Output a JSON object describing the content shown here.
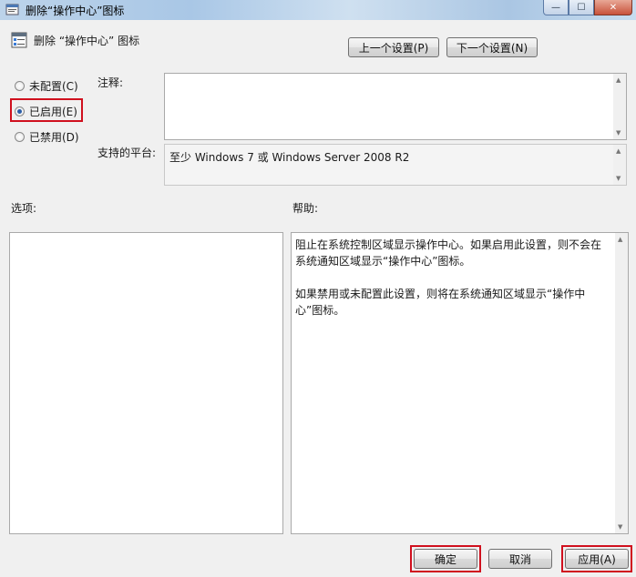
{
  "window": {
    "title": "删除“操作中心”图标"
  },
  "header": {
    "policy_name": "删除 “操作中心” 图标",
    "prev_setting": "上一个设置(P)",
    "next_setting": "下一个设置(N)"
  },
  "radios": [
    {
      "label": "未配置(C)",
      "checked": false
    },
    {
      "label": "已启用(E)",
      "checked": true
    },
    {
      "label": "已禁用(D)",
      "checked": false
    }
  ],
  "comment": {
    "label": "注释:",
    "value": ""
  },
  "platform": {
    "label": "支持的平台:",
    "value": "至少 Windows 7 或 Windows Server 2008 R2"
  },
  "options": {
    "label": "选项:"
  },
  "help": {
    "label": "帮助:",
    "para1": "阻止在系统控制区域显示操作中心。如果启用此设置，则不会在系统通知区域显示“操作中心”图标。",
    "para2": "如果禁用或未配置此设置，则将在系统通知区域显示“操作中心”图标。"
  },
  "footer": {
    "ok": "确定",
    "cancel": "取消",
    "apply": "应用(A)"
  },
  "colors": {
    "highlight": "#d0101e",
    "radio_dot": "#2a5da8"
  }
}
